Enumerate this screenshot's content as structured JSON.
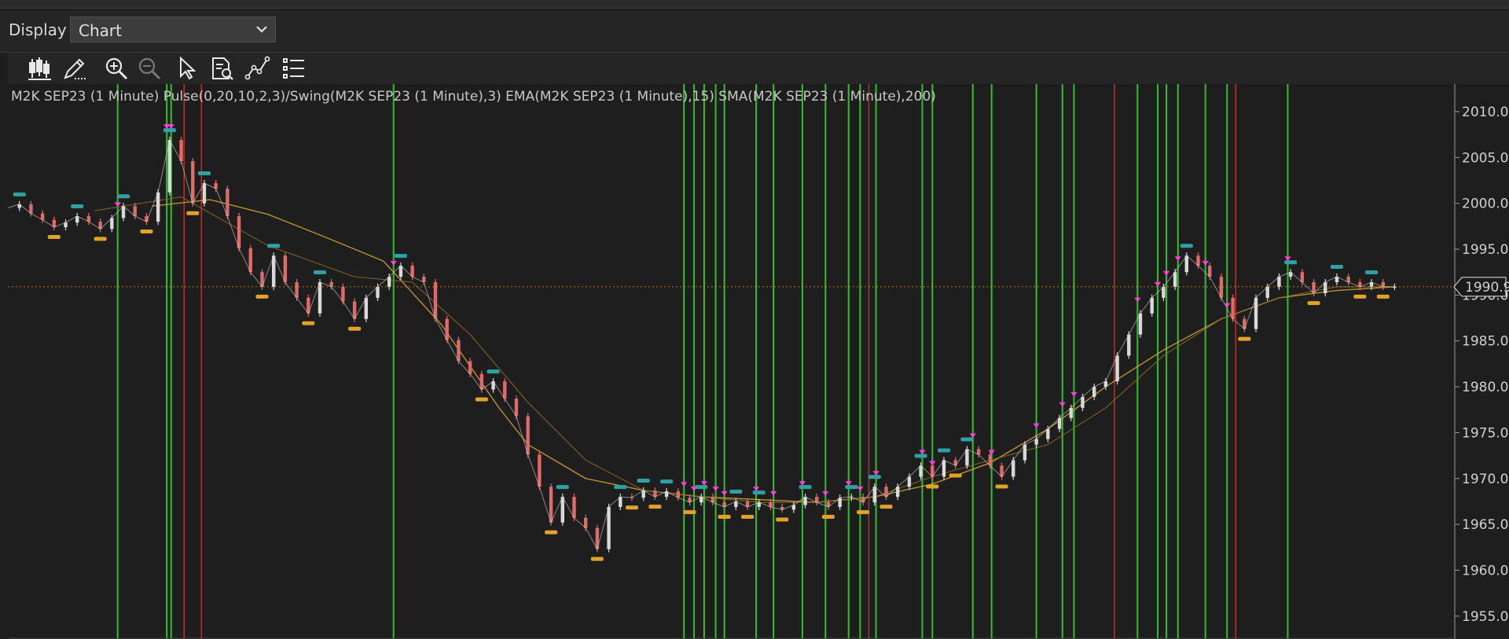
{
  "display": {
    "label": "Display",
    "selected": "Chart"
  },
  "toolbar": {
    "tools": [
      {
        "name": "bar-style-icon",
        "title": "Chart style"
      },
      {
        "name": "draw-pencil-icon",
        "title": "Drawing tools"
      },
      {
        "name": "zoom-in-icon",
        "title": "Zoom in"
      },
      {
        "name": "zoom-out-icon",
        "title": "Zoom out"
      },
      {
        "name": "pointer-icon",
        "title": "Select"
      },
      {
        "name": "data-box-icon",
        "title": "Data box"
      },
      {
        "name": "indicators-icon",
        "title": "Indicators"
      },
      {
        "name": "properties-list-icon",
        "title": "Properties"
      }
    ]
  },
  "colors": {
    "background": "#1e1e1e",
    "green_marker": "#35d12e",
    "red_marker": "#c0392b",
    "ema_line": "#d6a32e",
    "swing_orange": "#e2a229",
    "swing_teal": "#2ea1a4",
    "price_up": "#d9d9d9",
    "price_down": "#e06a6a",
    "arrow_magenta": "#ff3ddc",
    "last_price_tag": "#1a1a1a"
  },
  "chart_data": {
    "type": "candlestick",
    "instrument_line": "M2K SEP23 (1 Minute)  Pulse(0,20,10,2,3)/Swing(M2K SEP23 (1 Minute),3)  EMA(M2K SEP23 (1 Minute),15)  SMA(M2K SEP23 (1 Minute),200)",
    "y_axis": {
      "ticks": [
        2010.0,
        2005.0,
        2000.0,
        1995.0,
        1990.0,
        1985.0,
        1980.0,
        1975.0,
        1970.0,
        1965.0,
        1960.0,
        1955.0
      ],
      "tick_labels": [
        "2010.0",
        "2005.0",
        "2000.0",
        "1995.0",
        "1990.0",
        "1985.0",
        "1980.0",
        "1975.0",
        "1970.0",
        "1965.0",
        "1960.0",
        "1955.0"
      ],
      "ylim": [
        1952.5,
        2013.0
      ],
      "last_price": 1990.9,
      "last_price_label": "1990.9"
    },
    "price_path": [
      [
        0.0,
        1999.5
      ],
      [
        0.8,
        1999.9
      ],
      [
        1.6,
        1998.9
      ],
      [
        2.4,
        1998.2
      ],
      [
        3.2,
        1997.4
      ],
      [
        4.0,
        1997.9
      ],
      [
        4.8,
        1998.6
      ],
      [
        5.6,
        1998.0
      ],
      [
        6.4,
        1997.2
      ],
      [
        7.2,
        1998.4
      ],
      [
        8.0,
        1999.7
      ],
      [
        8.8,
        1998.6
      ],
      [
        9.6,
        1998.0
      ],
      [
        10.4,
        2001.2
      ],
      [
        11.2,
        2006.9
      ],
      [
        12.0,
        2004.6
      ],
      [
        12.8,
        2000.0
      ],
      [
        13.6,
        2002.2
      ],
      [
        14.4,
        2001.6
      ],
      [
        15.2,
        1998.6
      ],
      [
        16.0,
        1995.1
      ],
      [
        16.8,
        1992.5
      ],
      [
        17.6,
        1990.9
      ],
      [
        18.4,
        1994.3
      ],
      [
        19.2,
        1991.4
      ],
      [
        20.0,
        1989.7
      ],
      [
        20.8,
        1988.0
      ],
      [
        21.6,
        1991.4
      ],
      [
        22.4,
        1990.9
      ],
      [
        23.2,
        1989.3
      ],
      [
        24.0,
        1987.4
      ],
      [
        24.8,
        1989.7
      ],
      [
        25.6,
        1990.9
      ],
      [
        26.4,
        1992.0
      ],
      [
        27.2,
        1993.2
      ],
      [
        28.0,
        1992.0
      ],
      [
        28.8,
        1991.4
      ],
      [
        29.6,
        1987.4
      ],
      [
        30.4,
        1985.1
      ],
      [
        31.2,
        1982.8
      ],
      [
        32.0,
        1981.4
      ],
      [
        32.8,
        1979.7
      ],
      [
        33.6,
        1980.6
      ],
      [
        34.4,
        1978.7
      ],
      [
        35.2,
        1976.8
      ],
      [
        36.0,
        1972.6
      ],
      [
        36.8,
        1969.1
      ],
      [
        37.6,
        1965.2
      ],
      [
        38.4,
        1968.0
      ],
      [
        39.2,
        1965.7
      ],
      [
        40.0,
        1964.6
      ],
      [
        40.8,
        1962.3
      ],
      [
        41.6,
        1966.9
      ],
      [
        42.4,
        1968.0
      ],
      [
        43.2,
        1967.9
      ],
      [
        44.0,
        1968.7
      ],
      [
        44.8,
        1968.0
      ],
      [
        45.6,
        1968.6
      ],
      [
        46.4,
        1967.9
      ],
      [
        47.2,
        1967.4
      ],
      [
        48.0,
        1968.0
      ],
      [
        48.8,
        1967.4
      ],
      [
        49.6,
        1966.9
      ],
      [
        50.4,
        1967.5
      ],
      [
        51.2,
        1966.9
      ],
      [
        52.0,
        1967.4
      ],
      [
        52.8,
        1966.9
      ],
      [
        53.6,
        1966.6
      ],
      [
        54.4,
        1967.1
      ],
      [
        55.2,
        1968.0
      ],
      [
        56.0,
        1967.4
      ],
      [
        56.8,
        1966.9
      ],
      [
        57.6,
        1967.9
      ],
      [
        58.4,
        1968.0
      ],
      [
        59.2,
        1967.4
      ],
      [
        60.0,
        1969.1
      ],
      [
        60.8,
        1968.0
      ],
      [
        61.6,
        1969.1
      ],
      [
        62.4,
        1970.2
      ],
      [
        63.2,
        1971.4
      ],
      [
        64.0,
        1970.2
      ],
      [
        64.8,
        1972.0
      ],
      [
        65.6,
        1971.4
      ],
      [
        66.4,
        1973.2
      ],
      [
        67.2,
        1972.6
      ],
      [
        68.0,
        1971.4
      ],
      [
        68.8,
        1970.2
      ],
      [
        69.6,
        1972.0
      ],
      [
        70.4,
        1973.7
      ],
      [
        71.2,
        1974.3
      ],
      [
        72.0,
        1975.4
      ],
      [
        72.8,
        1976.6
      ],
      [
        73.6,
        1977.7
      ],
      [
        74.4,
        1978.9
      ],
      [
        75.2,
        1980.0
      ],
      [
        76.0,
        1980.6
      ],
      [
        76.8,
        1983.4
      ],
      [
        77.6,
        1985.7
      ],
      [
        78.4,
        1988.0
      ],
      [
        79.2,
        1989.7
      ],
      [
        80.0,
        1990.9
      ],
      [
        80.8,
        1992.5
      ],
      [
        81.6,
        1994.3
      ],
      [
        82.4,
        1993.2
      ],
      [
        83.2,
        1992.0
      ],
      [
        84.0,
        1989.7
      ],
      [
        84.8,
        1987.4
      ],
      [
        85.6,
        1986.3
      ],
      [
        86.4,
        1989.7
      ],
      [
        87.2,
        1990.9
      ],
      [
        88.0,
        1992.0
      ],
      [
        88.8,
        1992.5
      ],
      [
        89.6,
        1991.4
      ],
      [
        90.4,
        1990.2
      ],
      [
        91.2,
        1991.4
      ],
      [
        92.0,
        1992.0
      ],
      [
        92.8,
        1991.4
      ],
      [
        93.6,
        1990.9
      ],
      [
        94.4,
        1991.4
      ],
      [
        95.2,
        1990.9
      ],
      [
        96.0,
        1990.9
      ]
    ],
    "ema_path": [
      [
        6.0,
        1999.2
      ],
      [
        12.0,
        2000.7
      ],
      [
        18.0,
        1995.4
      ],
      [
        24.0,
        1992.0
      ],
      [
        28.0,
        1991.4
      ],
      [
        32.0,
        1985.7
      ],
      [
        36.0,
        1978.3
      ],
      [
        40.0,
        1972.0
      ],
      [
        44.0,
        1968.7
      ],
      [
        48.0,
        1968.0
      ],
      [
        52.0,
        1967.4
      ],
      [
        56.0,
        1967.4
      ],
      [
        60.0,
        1968.0
      ],
      [
        64.0,
        1970.2
      ],
      [
        68.0,
        1972.0
      ],
      [
        72.0,
        1973.7
      ],
      [
        76.0,
        1977.7
      ],
      [
        80.0,
        1983.4
      ],
      [
        84.0,
        1987.4
      ],
      [
        88.0,
        1989.7
      ],
      [
        92.0,
        1990.9
      ],
      [
        96.0,
        1990.9
      ]
    ],
    "sma_path": [
      [
        10.0,
        1999.7
      ],
      [
        14.0,
        2000.4
      ],
      [
        18.0,
        1998.8
      ],
      [
        22.0,
        1996.3
      ],
      [
        26.0,
        1993.7
      ],
      [
        30.0,
        1986.8
      ],
      [
        34.0,
        1977.7
      ],
      [
        36.0,
        1973.7
      ],
      [
        40.0,
        1970.0
      ],
      [
        44.0,
        1968.7
      ],
      [
        48.0,
        1968.0
      ],
      [
        52.0,
        1967.7
      ],
      [
        56.0,
        1967.4
      ],
      [
        60.0,
        1968.0
      ],
      [
        64.0,
        1969.4
      ],
      [
        68.0,
        1971.7
      ],
      [
        72.0,
        1975.4
      ],
      [
        76.0,
        1980.0
      ],
      [
        80.0,
        1984.0
      ],
      [
        84.0,
        1987.4
      ],
      [
        88.0,
        1989.7
      ],
      [
        92.0,
        1990.5
      ],
      [
        96.0,
        1990.9
      ]
    ],
    "green_markers": [
      7.6,
      11.0,
      11.3,
      26.7,
      46.8,
      47.5,
      48.2,
      49.0,
      49.6,
      51.8,
      53.0,
      55.0,
      56.6,
      58.2,
      59.0,
      60.1,
      63.3,
      64.0,
      66.8,
      68.1,
      71.2,
      73.0,
      73.8,
      78.2,
      79.6,
      80.2,
      81.0,
      82.9,
      84.4,
      88.6
    ],
    "red_markers": [
      12.2,
      13.4,
      59.6,
      76.6,
      85.0
    ]
  }
}
